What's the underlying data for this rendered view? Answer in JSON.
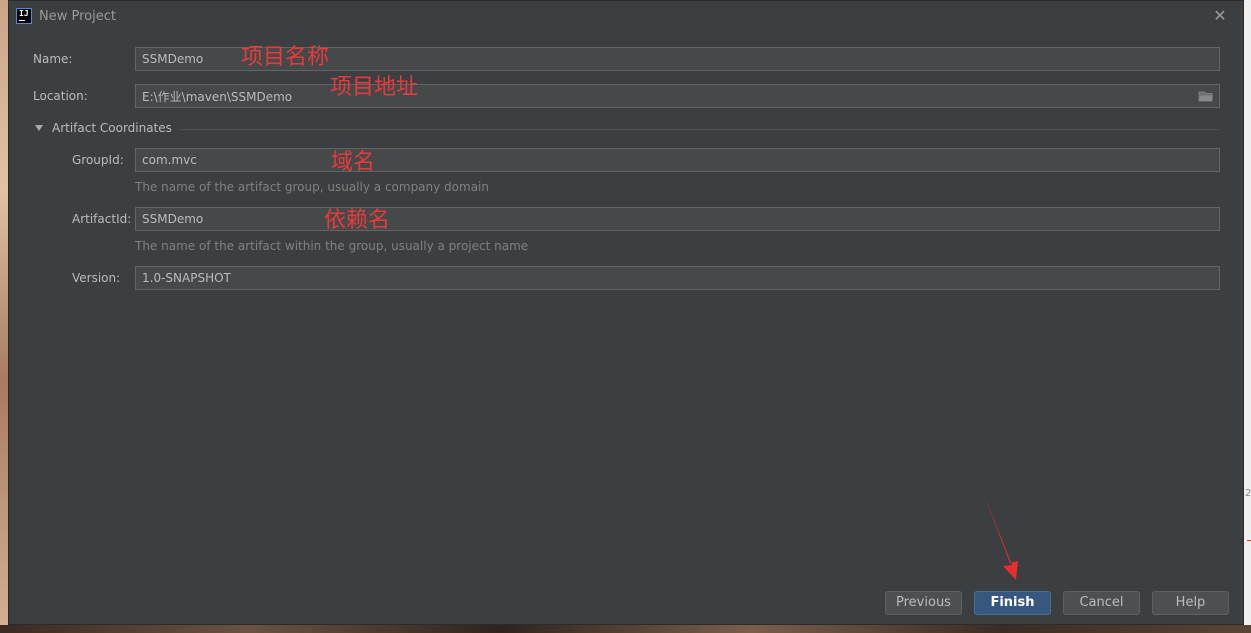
{
  "window": {
    "title": "New Project",
    "close_glyph": "✕"
  },
  "form": {
    "name": {
      "label": "Name:",
      "value": "SSMDemo"
    },
    "location": {
      "label": "Location:",
      "value": "E:\\作业\\maven\\SSMDemo"
    },
    "artifact_section": {
      "label": "Artifact Coordinates",
      "expanded": true
    },
    "group_id": {
      "label": "GroupId:",
      "value": "com.mvc",
      "hint": "The name of the artifact group, usually a company domain"
    },
    "artifact_id": {
      "label": "ArtifactId:",
      "value": "SSMDemo",
      "hint": "The name of the artifact within the group, usually a project name"
    },
    "version": {
      "label": "Version:",
      "value": "1.0-SNAPSHOT"
    }
  },
  "annotations": {
    "name": "项目名称",
    "location": "项目地址",
    "group_id": "域名",
    "artifact_id": "依赖名"
  },
  "buttons": {
    "previous": "Previous",
    "finish": "Finish",
    "cancel": "Cancel",
    "help": "Help"
  },
  "background": {
    "right_edge_mark": "2"
  },
  "colors": {
    "dialog_bg": "#3c3f41",
    "field_bg": "#45494a",
    "primary_button": "#365880",
    "annotation_red": "#e83a3a"
  },
  "icons": {
    "app": "intellij-idea-icon",
    "close": "close-icon",
    "folder": "folder-icon",
    "expand": "triangle-down-icon"
  }
}
